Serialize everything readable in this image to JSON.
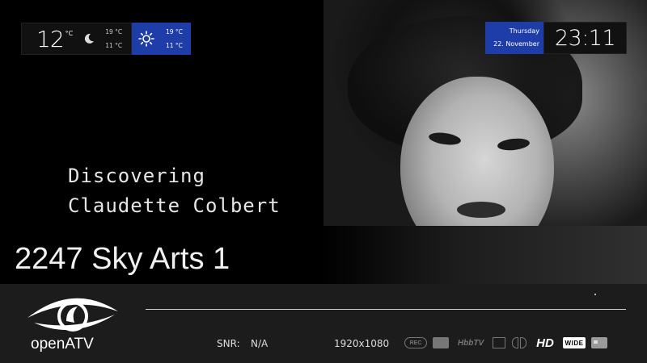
{
  "weather": {
    "current_temp": "12",
    "unit": "°C",
    "today": {
      "icon": "moon-icon",
      "high": "19 °C",
      "low": "11 °C"
    },
    "tomorrow": {
      "icon": "sun-icon",
      "high": "19 °C",
      "low": "11 °C"
    }
  },
  "clock": {
    "day": "Thursday",
    "date": "22. November",
    "time": "23:11"
  },
  "event": {
    "title_line1": "Discovering",
    "title_line2": "Claudette Colbert"
  },
  "channel": {
    "label": "2247 Sky Arts 1"
  },
  "infobar": {
    "logo_text": "openATV",
    "snr_label": "SNR:",
    "snr_value": "N/A",
    "resolution": "1920x1080",
    "icons": {
      "rec": "REC",
      "hbbtv": "HbbTV",
      "hd": "HD",
      "wide": "WIDE"
    }
  },
  "colors": {
    "accent": "#1e3da8",
    "bar": "#1e1e1e"
  }
}
